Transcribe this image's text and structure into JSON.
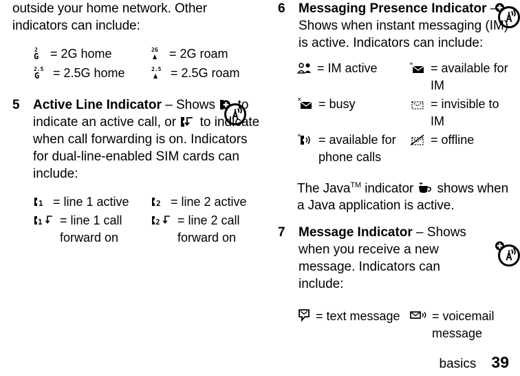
{
  "page": {
    "footer_section": "basics",
    "footer_page_number": "39",
    "ink_color": "#000000",
    "background_color": "#ffffff"
  },
  "left_column": {
    "intro_paragraph": "outside your home network. Other indicators can include:",
    "network_indicators": [
      {
        "icon": "2g-home-icon",
        "label": "= 2G home"
      },
      {
        "icon": "2g-roam-icon",
        "label": "= 2G roam"
      },
      {
        "icon": "25g-home-icon",
        "label": "= 2.5G home"
      },
      {
        "icon": "25g-roam-icon",
        "label": "= 2.5G roam"
      }
    ],
    "step": {
      "number": "5",
      "title": "Active Line Indicator",
      "dash": " – ",
      "text_part_1": "Shows ",
      "inline_icon_1": "active-call-icon",
      "text_part_2": " to indicate an active call, or ",
      "inline_icon_2": "call-forward-icon",
      "text_part_3": " to indicate when call forwarding is on. Indicators for dual-line-enabled SIM cards can include:"
    },
    "line_indicators": [
      {
        "icon": "line-1-active-icon",
        "label": "= line 1 active"
      },
      {
        "icon": "line-2-active-icon",
        "label": "= line 2 active"
      },
      {
        "icon": "line-1-call-forward-icon",
        "label": "= line 1 call forward on"
      },
      {
        "icon": "line-2-call-forward-icon",
        "label": "= line 2 call forward on"
      }
    ]
  },
  "right_column": {
    "step_6": {
      "number": "6",
      "title": "Messaging Presence Indicator",
      "dash": " – ",
      "text": "Shows when instant messaging (IM) is active. Indicators can include:"
    },
    "im_indicators": [
      {
        "icon": "im-active-icon",
        "label": "= IM active"
      },
      {
        "icon": "available-for-im-icon",
        "label": "= available for IM"
      },
      {
        "icon": "busy-icon",
        "label": "= busy"
      },
      {
        "icon": "invisible-to-im-icon",
        "label": "= invisible to IM"
      },
      {
        "icon": "available-for-phone-calls-icon",
        "label": "= available for phone calls"
      },
      {
        "icon": "offline-icon",
        "label": "= offline"
      }
    ],
    "java_note": {
      "text_part_1": "The Java",
      "trademark": "TM",
      "text_part_2": " indicator ",
      "inline_icon": "java-coffee-cup-icon",
      "text_part_3": " shows when a Java application is active."
    },
    "step_7": {
      "number": "7",
      "title": "Message Indicator",
      "dash": " – ",
      "text": "Shows when you receive a new message. Indicators can include:"
    },
    "message_indicators": [
      {
        "icon": "text-message-icon",
        "label": "= text message"
      },
      {
        "icon": "voicemail-message-icon",
        "label": "= voicemail message"
      }
    ]
  },
  "margin_icons": [
    {
      "name": "network-antenna-margin-icon-1",
      "depicts": "circle with antenna tower and plus badge"
    },
    {
      "name": "network-antenna-margin-icon-2",
      "depicts": "circle with antenna tower and plus badge"
    },
    {
      "name": "network-antenna-margin-icon-3",
      "depicts": "circle with antenna tower and plus badge"
    }
  ]
}
